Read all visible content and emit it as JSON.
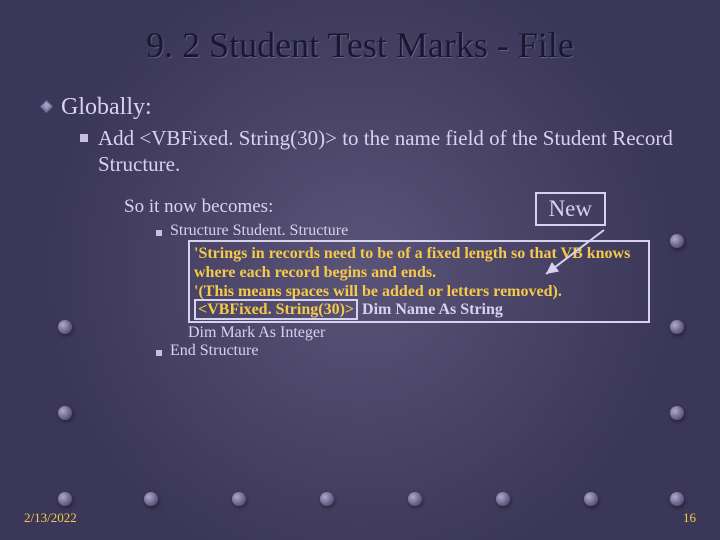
{
  "title": "9. 2 Student Test Marks - File",
  "levels": {
    "globally": "Globally:",
    "add_line_prefix": "Add ",
    "add_line_code": "<VBFixed. String(30)>",
    "add_line_suffix": " to the name field of the Student Record Structure.",
    "so_it": "So it now becomes:",
    "new_label": "New",
    "struct_open": "Structure Student. Structure",
    "hb1": "'Strings in records need to be of a fixed length so that VB knows where each record begins and ends.",
    "hb2": "'(This means spaces will be added or letters removed).",
    "hb_attr": "<VBFixed. String(30)>",
    "hb_dim": " Dim Name As String",
    "dim_mark": "Dim Mark As Integer",
    "struct_close": "End Structure"
  },
  "footer": {
    "date": "2/13/2022",
    "page": "16"
  }
}
